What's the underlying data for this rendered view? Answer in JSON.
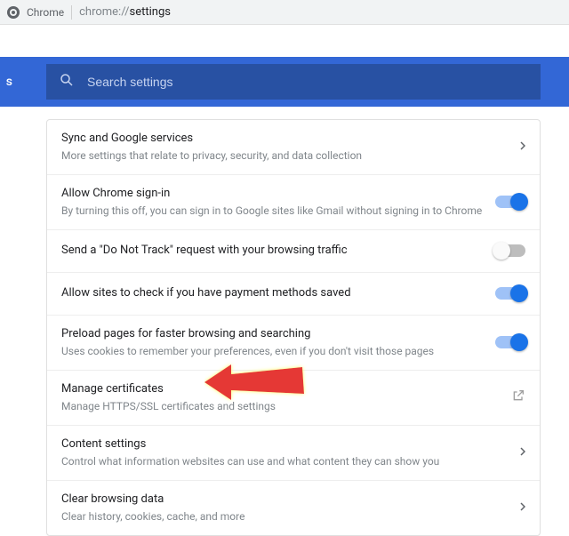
{
  "addressbar": {
    "app": "Chrome",
    "url_prefix": "chrome://",
    "url_path": "settings"
  },
  "sidebar": {
    "fragment": "s"
  },
  "search": {
    "placeholder": "Search settings"
  },
  "rows": [
    {
      "title": "Sync and Google services",
      "sub": "More settings that relate to privacy, security, and data collection",
      "action": "chevron"
    },
    {
      "title": "Allow Chrome sign-in",
      "sub": "By turning this off, you can sign in to Google sites like Gmail without signing in to Chrome",
      "action": "toggle",
      "on": true
    },
    {
      "title": "Send a \"Do Not Track\" request with your browsing traffic",
      "sub": "",
      "action": "toggle",
      "on": false
    },
    {
      "title": "Allow sites to check if you have payment methods saved",
      "sub": "",
      "action": "toggle",
      "on": true
    },
    {
      "title": "Preload pages for faster browsing and searching",
      "sub": "Uses cookies to remember your preferences, even if you don't visit those pages",
      "action": "toggle",
      "on": true
    },
    {
      "title": "Manage certificates",
      "sub": "Manage HTTPS/SSL certificates and settings",
      "action": "external"
    },
    {
      "title": "Content settings",
      "sub": "Control what information websites can use and what content they can show you",
      "action": "chevron"
    },
    {
      "title": "Clear browsing data",
      "sub": "Clear history, cookies, cache, and more",
      "action": "chevron"
    }
  ]
}
